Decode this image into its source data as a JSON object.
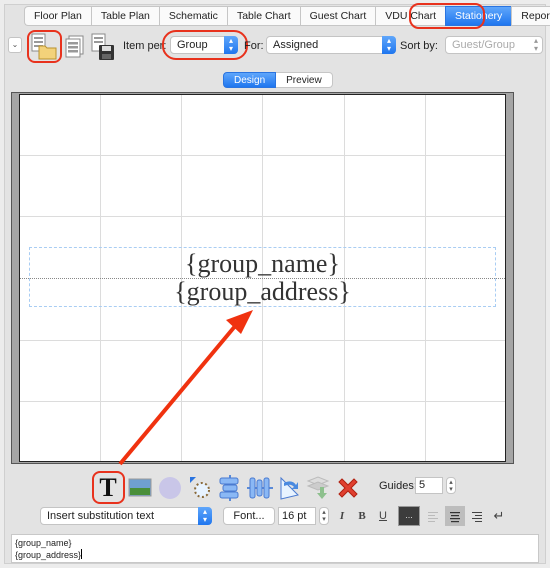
{
  "tabs": [
    {
      "label": "Floor Plan",
      "active": false
    },
    {
      "label": "Table Plan",
      "active": false
    },
    {
      "label": "Schematic",
      "active": false
    },
    {
      "label": "Table Chart",
      "active": false
    },
    {
      "label": "Guest Chart",
      "active": false
    },
    {
      "label": "VDU Chart",
      "active": false
    },
    {
      "label": "Stationery",
      "active": true
    },
    {
      "label": "Report",
      "active": false
    }
  ],
  "toolbar": {
    "collapse_icon": "⌄",
    "open_icon": "open-folder-icon",
    "list_icon": "document-list-icon",
    "save_icon": "save-disk-icon",
    "item_per_label": "Item per:",
    "item_per_value": "Group",
    "for_label": "For:",
    "for_value": "Assigned",
    "sort_by_label": "Sort by:",
    "sort_by_value": "Guest/Group"
  },
  "view_toggle": {
    "design_label": "Design",
    "preview_label": "Preview",
    "selected": "Design"
  },
  "canvas": {
    "text_lines": [
      "{group_name}",
      "{group_address}"
    ]
  },
  "tools": {
    "text_tool": "T",
    "guides_label": "Guides:",
    "guides_value": "5"
  },
  "format": {
    "insert_label": "Insert substitution text",
    "font_button": "Font...",
    "size_value": "16 pt",
    "italic": "I",
    "bold": "B",
    "underline": "U",
    "color_label": "...",
    "return_glyph": "↵",
    "alignment": "center"
  },
  "editor": {
    "lines": [
      "{group_name}",
      "{group_address}"
    ]
  },
  "colors": {
    "accent": "#1f76ef",
    "annotation": "#e8321d"
  }
}
